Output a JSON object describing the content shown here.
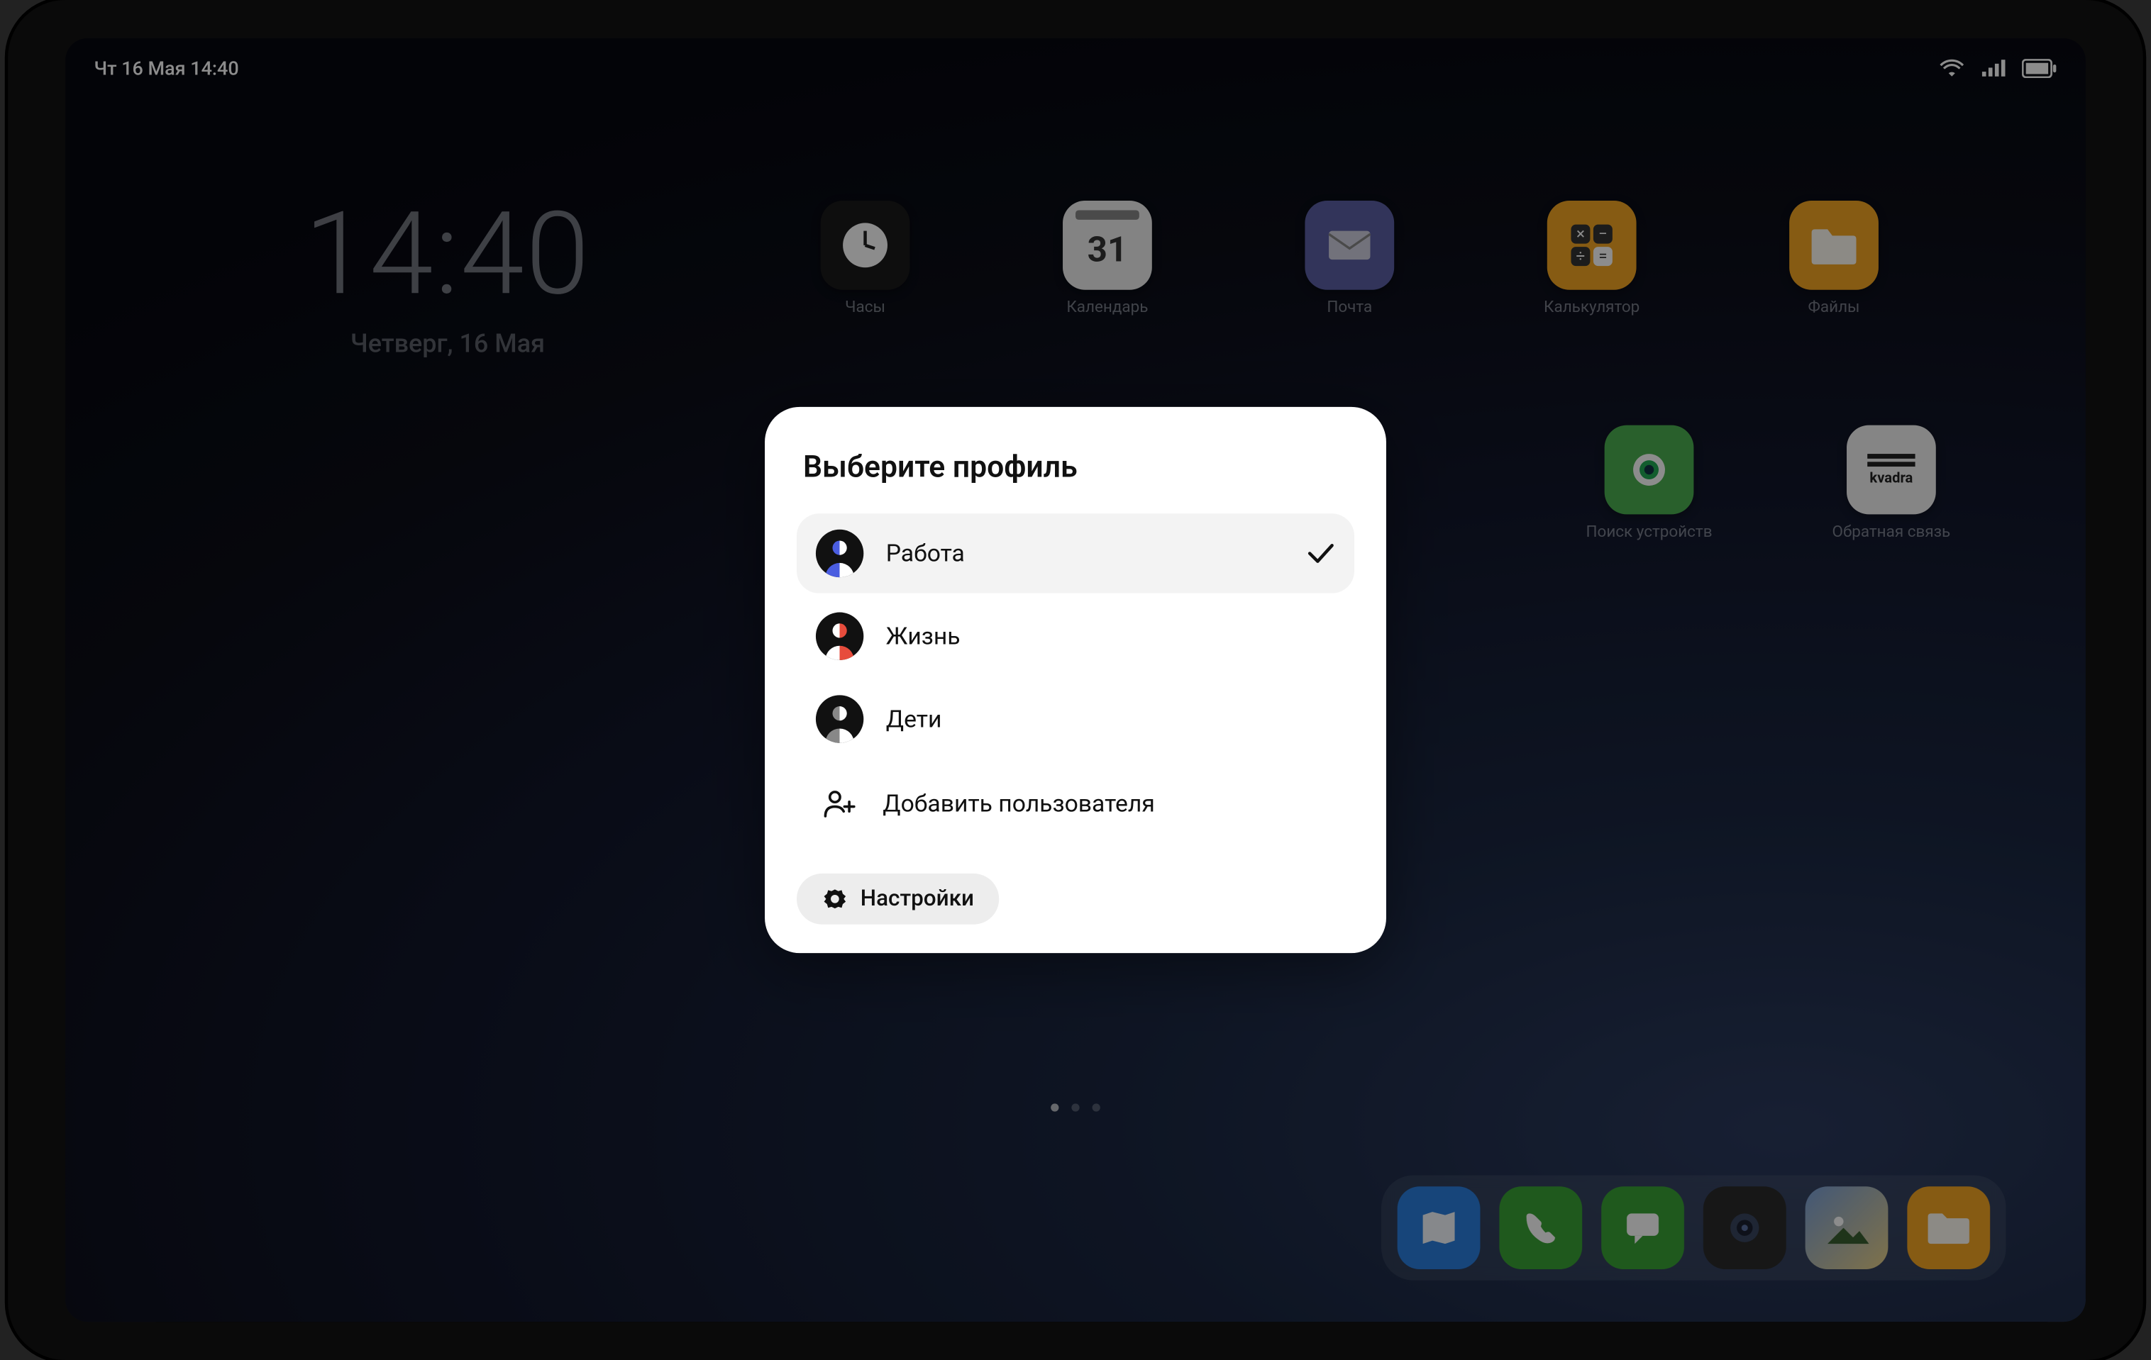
{
  "status_bar": {
    "datetime": "Чт 16 Мая  14:40"
  },
  "clock_widget": {
    "time": "14:40",
    "date": "Четверг, 16 Мая"
  },
  "apps": {
    "row1": [
      {
        "label": "Часы",
        "icon": "clock"
      },
      {
        "label": "Календарь",
        "icon": "calendar",
        "day": "31"
      },
      {
        "label": "Почта",
        "icon": "mail"
      },
      {
        "label": "Калькулятор",
        "icon": "calc"
      },
      {
        "label": "Файлы",
        "icon": "files"
      }
    ],
    "row2": [
      {
        "label": "Поиск устройств",
        "icon": "search"
      },
      {
        "label": "Обратная связь",
        "icon": "kvadra",
        "text": "kvadra"
      }
    ]
  },
  "dock": [
    {
      "name": "maps"
    },
    {
      "name": "phone"
    },
    {
      "name": "messages"
    },
    {
      "name": "camera"
    },
    {
      "name": "gallery"
    },
    {
      "name": "filemanager"
    }
  ],
  "modal": {
    "title": "Выберите профиль",
    "profiles": [
      {
        "label": "Работа",
        "selected": true,
        "accent": "blue"
      },
      {
        "label": "Жизнь",
        "selected": false,
        "accent": "red"
      },
      {
        "label": "Дети",
        "selected": false,
        "accent": "grey"
      }
    ],
    "add_user": "Добавить пользователя",
    "settings": "Настройки"
  }
}
